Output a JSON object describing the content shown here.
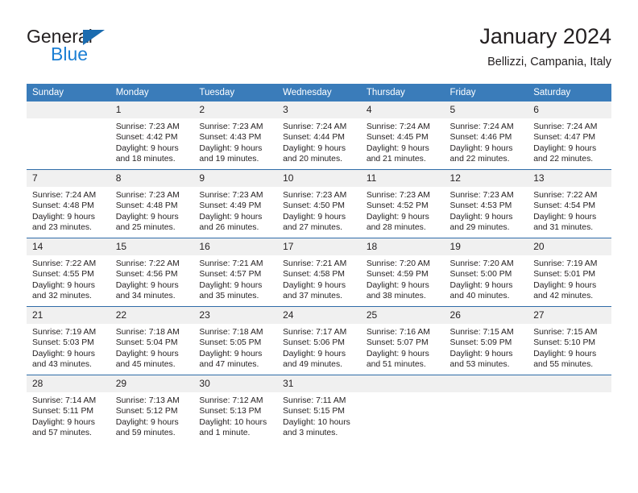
{
  "brand": {
    "name_part1": "General",
    "name_part2": "Blue",
    "triangle_icon": "blue-triangle-icon",
    "accent_color": "#1b7fd4"
  },
  "header": {
    "title": "January 2024",
    "subtitle": "Bellizzi, Campania, Italy"
  },
  "theme": {
    "header_bg": "#3a7cba",
    "header_text": "#ffffff",
    "daynum_bg": "#f0f0f0",
    "row_border": "#2f6ca8",
    "body_text": "#231f20"
  },
  "weekday_headers": [
    "Sunday",
    "Monday",
    "Tuesday",
    "Wednesday",
    "Thursday",
    "Friday",
    "Saturday"
  ],
  "weeks": [
    [
      {
        "day": "",
        "lines": []
      },
      {
        "day": "1",
        "lines": [
          "Sunrise: 7:23 AM",
          "Sunset: 4:42 PM",
          "Daylight: 9 hours",
          "and 18 minutes."
        ]
      },
      {
        "day": "2",
        "lines": [
          "Sunrise: 7:23 AM",
          "Sunset: 4:43 PM",
          "Daylight: 9 hours",
          "and 19 minutes."
        ]
      },
      {
        "day": "3",
        "lines": [
          "Sunrise: 7:24 AM",
          "Sunset: 4:44 PM",
          "Daylight: 9 hours",
          "and 20 minutes."
        ]
      },
      {
        "day": "4",
        "lines": [
          "Sunrise: 7:24 AM",
          "Sunset: 4:45 PM",
          "Daylight: 9 hours",
          "and 21 minutes."
        ]
      },
      {
        "day": "5",
        "lines": [
          "Sunrise: 7:24 AM",
          "Sunset: 4:46 PM",
          "Daylight: 9 hours",
          "and 22 minutes."
        ]
      },
      {
        "day": "6",
        "lines": [
          "Sunrise: 7:24 AM",
          "Sunset: 4:47 PM",
          "Daylight: 9 hours",
          "and 22 minutes."
        ]
      }
    ],
    [
      {
        "day": "7",
        "lines": [
          "Sunrise: 7:24 AM",
          "Sunset: 4:48 PM",
          "Daylight: 9 hours",
          "and 23 minutes."
        ]
      },
      {
        "day": "8",
        "lines": [
          "Sunrise: 7:23 AM",
          "Sunset: 4:48 PM",
          "Daylight: 9 hours",
          "and 25 minutes."
        ]
      },
      {
        "day": "9",
        "lines": [
          "Sunrise: 7:23 AM",
          "Sunset: 4:49 PM",
          "Daylight: 9 hours",
          "and 26 minutes."
        ]
      },
      {
        "day": "10",
        "lines": [
          "Sunrise: 7:23 AM",
          "Sunset: 4:50 PM",
          "Daylight: 9 hours",
          "and 27 minutes."
        ]
      },
      {
        "day": "11",
        "lines": [
          "Sunrise: 7:23 AM",
          "Sunset: 4:52 PM",
          "Daylight: 9 hours",
          "and 28 minutes."
        ]
      },
      {
        "day": "12",
        "lines": [
          "Sunrise: 7:23 AM",
          "Sunset: 4:53 PM",
          "Daylight: 9 hours",
          "and 29 minutes."
        ]
      },
      {
        "day": "13",
        "lines": [
          "Sunrise: 7:22 AM",
          "Sunset: 4:54 PM",
          "Daylight: 9 hours",
          "and 31 minutes."
        ]
      }
    ],
    [
      {
        "day": "14",
        "lines": [
          "Sunrise: 7:22 AM",
          "Sunset: 4:55 PM",
          "Daylight: 9 hours",
          "and 32 minutes."
        ]
      },
      {
        "day": "15",
        "lines": [
          "Sunrise: 7:22 AM",
          "Sunset: 4:56 PM",
          "Daylight: 9 hours",
          "and 34 minutes."
        ]
      },
      {
        "day": "16",
        "lines": [
          "Sunrise: 7:21 AM",
          "Sunset: 4:57 PM",
          "Daylight: 9 hours",
          "and 35 minutes."
        ]
      },
      {
        "day": "17",
        "lines": [
          "Sunrise: 7:21 AM",
          "Sunset: 4:58 PM",
          "Daylight: 9 hours",
          "and 37 minutes."
        ]
      },
      {
        "day": "18",
        "lines": [
          "Sunrise: 7:20 AM",
          "Sunset: 4:59 PM",
          "Daylight: 9 hours",
          "and 38 minutes."
        ]
      },
      {
        "day": "19",
        "lines": [
          "Sunrise: 7:20 AM",
          "Sunset: 5:00 PM",
          "Daylight: 9 hours",
          "and 40 minutes."
        ]
      },
      {
        "day": "20",
        "lines": [
          "Sunrise: 7:19 AM",
          "Sunset: 5:01 PM",
          "Daylight: 9 hours",
          "and 42 minutes."
        ]
      }
    ],
    [
      {
        "day": "21",
        "lines": [
          "Sunrise: 7:19 AM",
          "Sunset: 5:03 PM",
          "Daylight: 9 hours",
          "and 43 minutes."
        ]
      },
      {
        "day": "22",
        "lines": [
          "Sunrise: 7:18 AM",
          "Sunset: 5:04 PM",
          "Daylight: 9 hours",
          "and 45 minutes."
        ]
      },
      {
        "day": "23",
        "lines": [
          "Sunrise: 7:18 AM",
          "Sunset: 5:05 PM",
          "Daylight: 9 hours",
          "and 47 minutes."
        ]
      },
      {
        "day": "24",
        "lines": [
          "Sunrise: 7:17 AM",
          "Sunset: 5:06 PM",
          "Daylight: 9 hours",
          "and 49 minutes."
        ]
      },
      {
        "day": "25",
        "lines": [
          "Sunrise: 7:16 AM",
          "Sunset: 5:07 PM",
          "Daylight: 9 hours",
          "and 51 minutes."
        ]
      },
      {
        "day": "26",
        "lines": [
          "Sunrise: 7:15 AM",
          "Sunset: 5:09 PM",
          "Daylight: 9 hours",
          "and 53 minutes."
        ]
      },
      {
        "day": "27",
        "lines": [
          "Sunrise: 7:15 AM",
          "Sunset: 5:10 PM",
          "Daylight: 9 hours",
          "and 55 minutes."
        ]
      }
    ],
    [
      {
        "day": "28",
        "lines": [
          "Sunrise: 7:14 AM",
          "Sunset: 5:11 PM",
          "Daylight: 9 hours",
          "and 57 minutes."
        ]
      },
      {
        "day": "29",
        "lines": [
          "Sunrise: 7:13 AM",
          "Sunset: 5:12 PM",
          "Daylight: 9 hours",
          "and 59 minutes."
        ]
      },
      {
        "day": "30",
        "lines": [
          "Sunrise: 7:12 AM",
          "Sunset: 5:13 PM",
          "Daylight: 10 hours",
          "and 1 minute."
        ]
      },
      {
        "day": "31",
        "lines": [
          "Sunrise: 7:11 AM",
          "Sunset: 5:15 PM",
          "Daylight: 10 hours",
          "and 3 minutes."
        ]
      },
      {
        "day": "",
        "lines": []
      },
      {
        "day": "",
        "lines": []
      },
      {
        "day": "",
        "lines": []
      }
    ]
  ]
}
